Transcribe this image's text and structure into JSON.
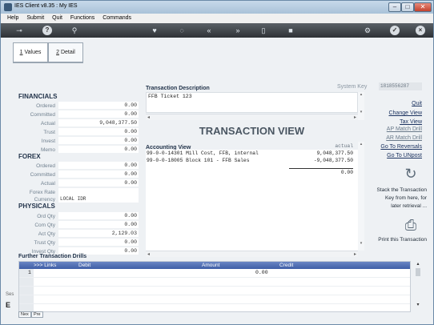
{
  "window": {
    "title": "IES Client v8.35 : My IES"
  },
  "menu": [
    "Help",
    "Submit",
    "Quit",
    "Functions",
    "Commands"
  ],
  "toolbar": {
    "icons": [
      "key-icon",
      "help-icon",
      "search-icon",
      "heart-icon",
      "history-icon",
      "back-icon",
      "forward-icon",
      "document-icon",
      "square-icon",
      "settings-icon",
      "check-icon",
      "close-icon"
    ]
  },
  "tabs": [
    {
      "key": "1",
      "label": "Values"
    },
    {
      "key": "2",
      "label": "Detail"
    }
  ],
  "financials": {
    "title": "FINANCIALS",
    "rows": [
      {
        "label": "Ordered",
        "value": "0.00"
      },
      {
        "label": "Committed",
        "value": "0.00"
      },
      {
        "label": "Actual",
        "value": "9,048,377.50"
      },
      {
        "label": "Trust",
        "value": "0.00"
      },
      {
        "label": "Invest",
        "value": "0.00"
      },
      {
        "label": "Memo",
        "value": "0.00"
      }
    ]
  },
  "forex": {
    "title": "FOREX",
    "rows": [
      {
        "label": "Ordered",
        "value": "0.00"
      },
      {
        "label": "Committed",
        "value": "0.00"
      },
      {
        "label": "Actual",
        "value": "0.00"
      },
      {
        "label": "Forex Rate",
        "value": ""
      },
      {
        "label": "Currency",
        "value": "LOCAL IDR"
      }
    ]
  },
  "physicals": {
    "title": "PHYSICALS",
    "rows": [
      {
        "label": "Ord Qty",
        "value": "0.00"
      },
      {
        "label": "Com Qty",
        "value": "0.00"
      },
      {
        "label": "Act Qty",
        "value": "2,129.03"
      },
      {
        "label": "Trust Qty",
        "value": "0.00"
      },
      {
        "label": "Invest Qty",
        "value": "0.00"
      }
    ]
  },
  "transaction": {
    "desc_label": "Transaction Description",
    "description": "FFB Ticket 123",
    "view_title": "TRANSACTION VIEW",
    "accounting_label": "Accounting View",
    "actual_header": "actual",
    "lines": [
      {
        "account": "99-0-0-14301 Mill Cost, FFB, internal",
        "amount": "9,048,377.50"
      },
      {
        "account": "99-0-0-18005 Block 101 - FFB Sales",
        "amount": "-9,048,377.50"
      }
    ],
    "total": "0.00"
  },
  "system_key": {
    "label": "System Key",
    "value": "1818556287"
  },
  "actions": {
    "links": [
      "Quit",
      "Change View",
      "Tax View",
      "AP Match Drill",
      "AR Match Drill",
      "Go To Reversals",
      "Go To UNpost"
    ],
    "stack_text": [
      "Stack the Transaction",
      "Key from here, for",
      "later retrieval ..."
    ],
    "print_text": "Print this Transaction"
  },
  "drills": {
    "title": "Further Transaction Drills",
    "headers": [
      ">>> Links",
      "Debit",
      "Amount",
      "Credit"
    ],
    "rows": [
      {
        "num": "1",
        "amount": "0.00"
      }
    ]
  },
  "bottom_tabs": [
    "Nex",
    "Pre"
  ],
  "left_edge": [
    "Ses",
    "E"
  ]
}
